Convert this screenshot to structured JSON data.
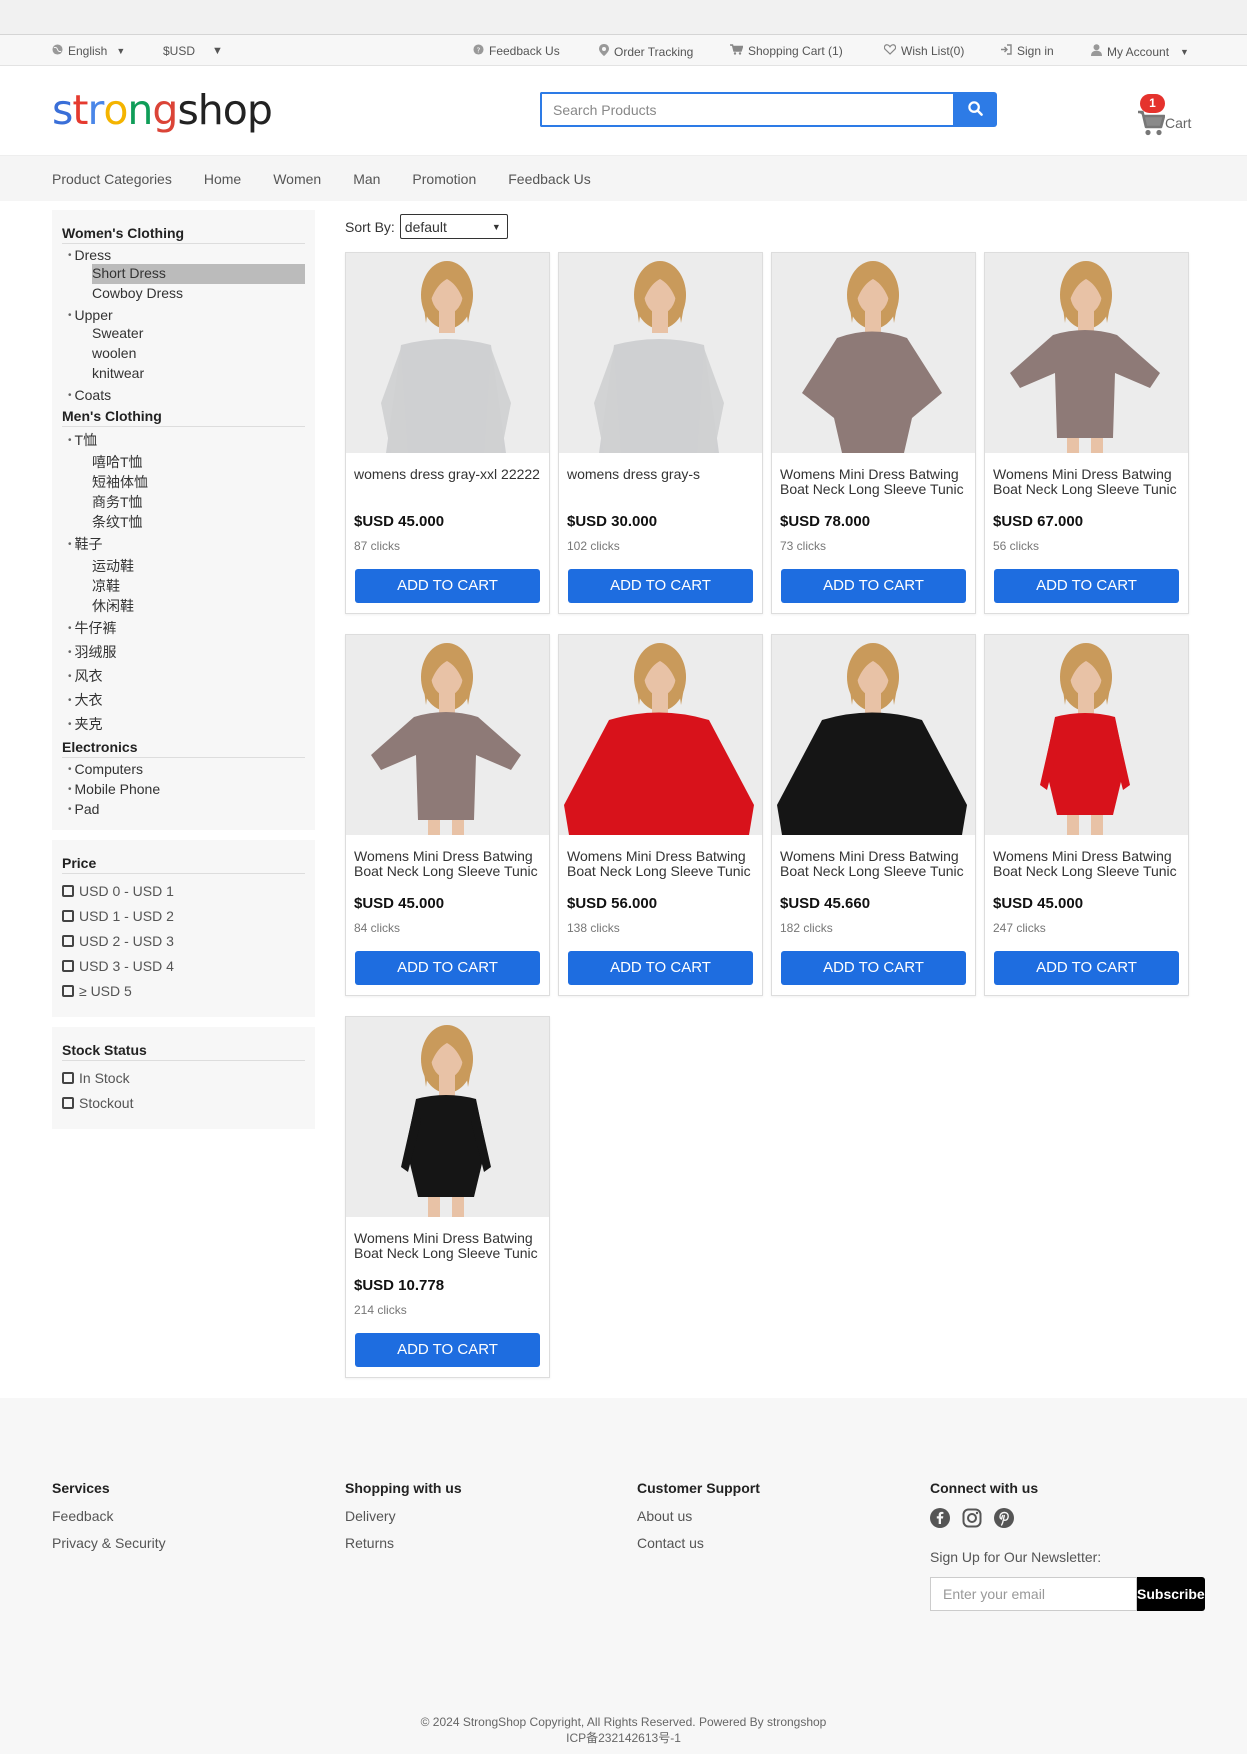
{
  "topbar": {
    "language": "English",
    "currency": "$USD",
    "feedback": "Feedback Us",
    "order_tracking": "Order Tracking",
    "shopping_cart": "Shopping Cart (1)",
    "wishlist": "Wish List(0)",
    "signin": "Sign in",
    "account": "My Account"
  },
  "header": {
    "logo_text": "strongshop",
    "search_placeholder": "Search Products",
    "cart_count": "1",
    "cart_label": "Cart"
  },
  "nav": [
    "Product Categories",
    "Home",
    "Women",
    "Man",
    "Promotion",
    "Feedback Us"
  ],
  "sidebar": {
    "categories": [
      {
        "title": "Women's Clothing",
        "groups": [
          {
            "label": "Dress",
            "items": [
              "Short Dress",
              "Cowboy Dress"
            ]
          },
          {
            "label": "Upper",
            "items": [
              "Sweater",
              "woolen",
              "knitwear"
            ]
          },
          {
            "label": "Coats",
            "items": []
          }
        ]
      },
      {
        "title": "Men's Clothing",
        "groups": [
          {
            "label": "T恤",
            "items": [
              "嘻哈T恤",
              "短袖体恤",
              "商务T恤",
              "条纹T恤"
            ]
          },
          {
            "label": "鞋子",
            "items": [
              "运动鞋",
              "凉鞋",
              "休闲鞋"
            ]
          },
          {
            "label": "牛仔裤",
            "items": []
          },
          {
            "label": "羽绒服",
            "items": []
          },
          {
            "label": "风衣",
            "items": []
          },
          {
            "label": "大衣",
            "items": []
          },
          {
            "label": "夹克",
            "items": []
          }
        ]
      },
      {
        "title": "Electronics",
        "groups": [
          {
            "label": "Computers",
            "items": []
          },
          {
            "label": "Mobile Phone",
            "items": []
          },
          {
            "label": "Pad",
            "items": []
          }
        ]
      }
    ],
    "active_item": "Short Dress",
    "price_title": "Price",
    "price_options": [
      "USD 0 - USD 1",
      "USD 1 - USD 2",
      "USD 2 - USD 3",
      "USD 3 - USD 4",
      "≥ USD 5"
    ],
    "stock_title": "Stock Status",
    "stock_options": [
      "In Stock",
      "Stockout"
    ]
  },
  "sort": {
    "label": "Sort By:",
    "value": "default"
  },
  "add_to_cart_label": "ADD TO CART",
  "products": [
    {
      "title": "womens dress gray-xxl 22222",
      "price": "$USD 45.000",
      "clicks": "87 clicks",
      "color": "#cfd0d2",
      "pose": "sweater"
    },
    {
      "title": "womens dress gray-s",
      "price": "$USD 30.000",
      "clicks": "102 clicks",
      "color": "#cfd0d2",
      "pose": "sweater"
    },
    {
      "title": "Womens Mini Dress Batwing Boat Neck Long Sleeve Tunic",
      "price": "$USD 78.000",
      "clicks": "73 clicks",
      "color": "#8e7a77",
      "pose": "back"
    },
    {
      "title": "Womens Mini Dress Batwing Boat Neck Long Sleeve Tunic",
      "price": "$USD 67.000",
      "clicks": "56 clicks",
      "color": "#8e7a77",
      "pose": "wide"
    },
    {
      "title": "Womens Mini Dress Batwing Boat Neck Long Sleeve Tunic",
      "price": "$USD 45.000",
      "clicks": "84 clicks",
      "color": "#8e7a77",
      "pose": "wide"
    },
    {
      "title": "Womens Mini Dress Batwing Boat Neck Long Sleeve Tunic",
      "price": "$USD 56.000",
      "clicks": "138 clicks",
      "color": "#d8121b",
      "pose": "close"
    },
    {
      "title": "Womens Mini Dress Batwing Boat Neck Long Sleeve Tunic",
      "price": "$USD 45.660",
      "clicks": "182 clicks",
      "color": "#151515",
      "pose": "close"
    },
    {
      "title": "Womens Mini Dress Batwing Boat Neck Long Sleeve Tunic",
      "price": "$USD 45.000",
      "clicks": "247 clicks",
      "color": "#d8121b",
      "pose": "dress"
    },
    {
      "title": "Womens Mini Dress Batwing Boat Neck Long Sleeve Tunic",
      "price": "$USD 10.778",
      "clicks": "214 clicks",
      "color": "#151515",
      "pose": "dress"
    }
  ],
  "footer": {
    "services_title": "Services",
    "services_links": [
      "Feedback",
      "Privacy & Security"
    ],
    "shopping_title": "Shopping with us",
    "shopping_links": [
      "Delivery",
      "Returns"
    ],
    "support_title": "Customer Support",
    "support_links": [
      "About us",
      "Contact us"
    ],
    "connect_title": "Connect with us",
    "social_icons": [
      "facebook-icon",
      "instagram-icon",
      "pinterest-icon"
    ],
    "newsletter_label": "Sign Up for Our Newsletter:",
    "newsletter_placeholder": "Enter your email",
    "subscribe_label": "Subscribe",
    "copyright": "© 2024 StrongShop Copyright, All Rights Reserved. Powered By strongshop",
    "icp": "ICP备232142613号-1"
  },
  "colors": {
    "accent": "#2d7be6",
    "button_blue": "#1e6de0",
    "badge_red": "#e5322d"
  }
}
